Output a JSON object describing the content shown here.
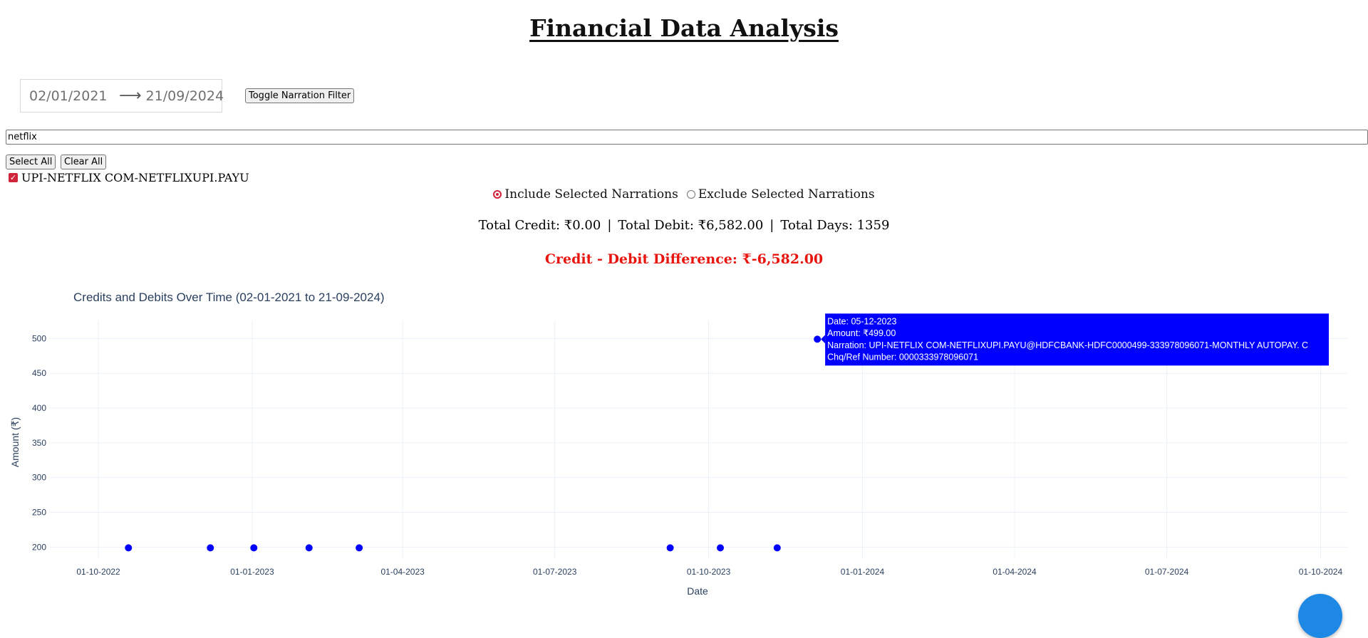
{
  "header": {
    "title": "Financial Data Analysis"
  },
  "filters": {
    "date_start": "02/01/2021",
    "date_end": "21/09/2024",
    "toggle_label": "Toggle Narration Filter",
    "search_value": "netflix",
    "select_all_label": "Select All",
    "clear_all_label": "Clear All",
    "narrations": [
      {
        "label": "UPI-NETFLIX COM-NETFLIXUPI.PAYU",
        "checked": true
      }
    ],
    "include_label": "Include Selected Narrations",
    "exclude_label": "Exclude Selected Narrations",
    "mode": "include",
    "accent_color": "#d0243b"
  },
  "summary": {
    "total_credit": "Total Credit: ₹0.00",
    "total_debit": "Total Debit: ₹6,582.00",
    "total_days": "Total Days: 1359",
    "separator": "|",
    "difference": "Credit - Debit Difference: ₹-6,582.00",
    "difference_color": "#e8150f"
  },
  "chart_data": {
    "type": "scatter",
    "title": "Credits and Debits Over Time (02-01-2021 to 21-09-2024)",
    "xlabel": "Date",
    "ylabel": "Amount (₹)",
    "x_ticks": [
      "01-10-2022",
      "01-01-2023",
      "01-04-2023",
      "01-07-2023",
      "01-10-2023",
      "01-01-2024",
      "01-04-2024",
      "01-07-2024",
      "01-10-2024"
    ],
    "y_ticks": [
      200,
      250,
      300,
      350,
      400,
      450,
      500
    ],
    "xlim": [
      "2022-09-02",
      "2024-10-17"
    ],
    "ylim": [
      184,
      526
    ],
    "grid": true,
    "point_color": "#0000ff",
    "series": [
      {
        "points": [
          {
            "x": "2022-10-19",
            "y": 199
          },
          {
            "x": "2022-12-07",
            "y": 199
          },
          {
            "x": "2023-01-02",
            "y": 199
          },
          {
            "x": "2023-02-04",
            "y": 199
          },
          {
            "x": "2023-03-06",
            "y": 199
          },
          {
            "x": "2023-09-08",
            "y": 199
          },
          {
            "x": "2023-10-08",
            "y": 199
          },
          {
            "x": "2023-11-11",
            "y": 199
          },
          {
            "x": "2023-12-05",
            "y": 499
          }
        ]
      }
    ],
    "tooltip": {
      "point_index": 8,
      "lines": [
        "Date: 05-12-2023",
        "Amount: ₹499.00",
        "Narration: UPI-NETFLIX COM-NETFLIXUPI.PAYU@HDFCBANK-HDFC0000499-333978096071-MONTHLY AUTOPAY. C",
        "Chq/Ref Number: 0000333978096071"
      ],
      "background": "#0000ff"
    }
  }
}
